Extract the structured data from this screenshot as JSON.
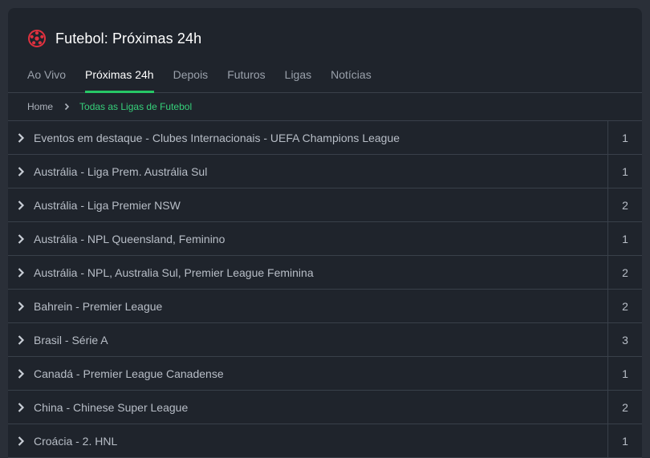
{
  "header": {
    "title": "Futebol: Próximas 24h",
    "icon": "soccer-ball-icon",
    "accent_color": "#e0313f"
  },
  "tabs": [
    {
      "label": "Ao Vivo",
      "active": false
    },
    {
      "label": "Próximas 24h",
      "active": true
    },
    {
      "label": "Depois",
      "active": false
    },
    {
      "label": "Futuros",
      "active": false
    },
    {
      "label": "Ligas",
      "active": false
    },
    {
      "label": "Notícias",
      "active": false
    }
  ],
  "breadcrumb": {
    "home": "Home",
    "current": "Todas as Ligas de Futebol"
  },
  "leagues": [
    {
      "label": "Eventos em destaque - Clubes Internacionais - UEFA Champions League",
      "count": "1"
    },
    {
      "label": "Austrália - Liga Prem. Austrália Sul",
      "count": "1"
    },
    {
      "label": "Austrália - Liga Premier NSW",
      "count": "2"
    },
    {
      "label": "Austrália - NPL Queensland, Feminino",
      "count": "1"
    },
    {
      "label": "Austrália - NPL, Australia Sul, Premier League Feminina",
      "count": "2"
    },
    {
      "label": "Bahrein - Premier League",
      "count": "2"
    },
    {
      "label": "Brasil - Série A",
      "count": "3"
    },
    {
      "label": "Canadá - Premier League Canadense",
      "count": "1"
    },
    {
      "label": "China - Chinese Super League",
      "count": "2"
    },
    {
      "label": "Croácia - 2. HNL",
      "count": "1"
    }
  ]
}
